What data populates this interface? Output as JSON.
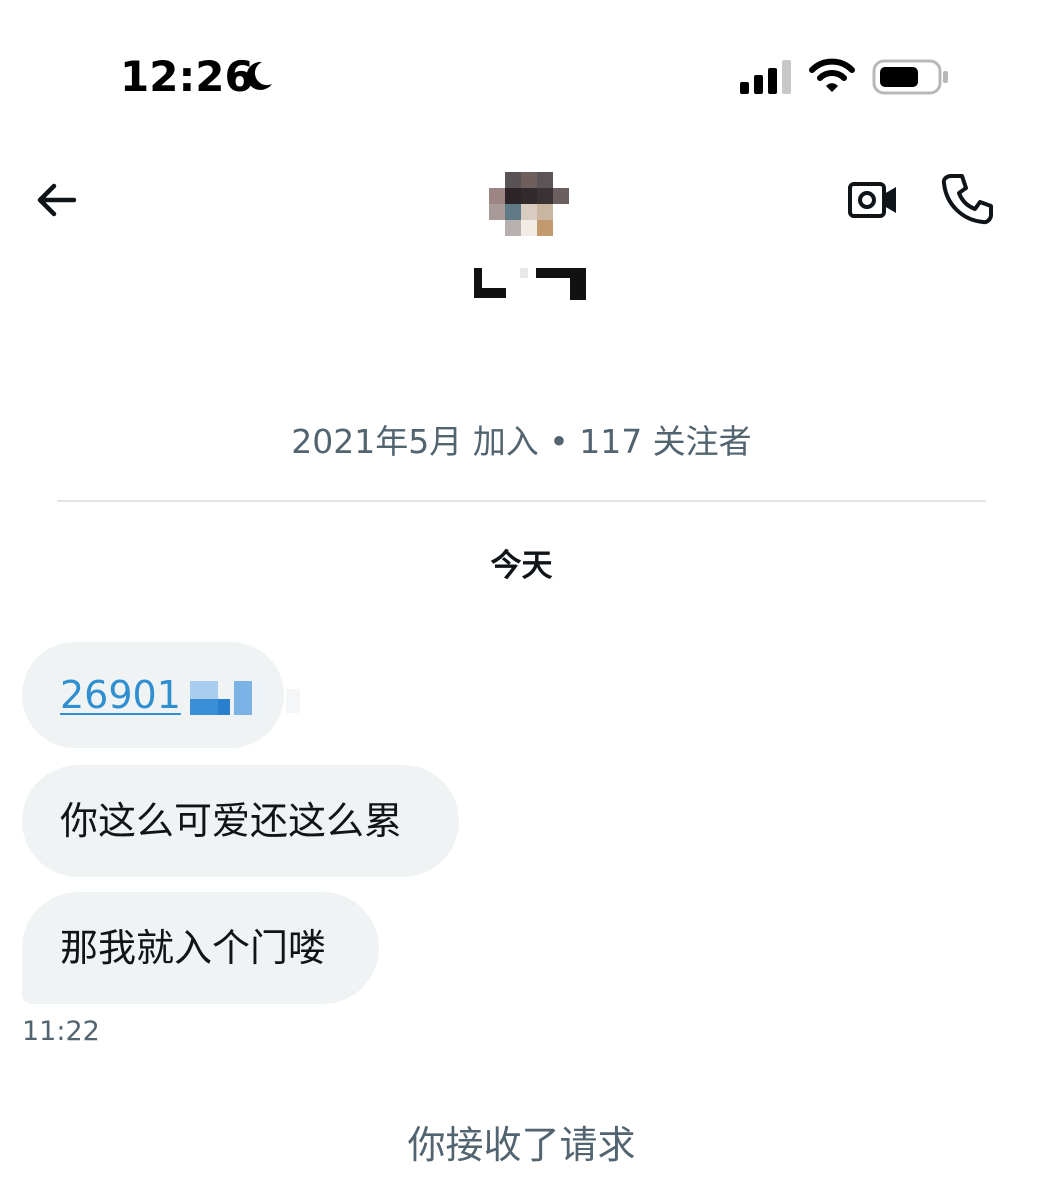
{
  "status_bar": {
    "time": "12:26",
    "focus_icon": "moon-icon",
    "signal_icon": "cellular-signal-icon",
    "wifi_icon": "wifi-icon",
    "battery_icon": "battery-icon"
  },
  "header": {
    "back_icon": "arrow-left-icon",
    "avatar": "pixelated-avatar",
    "video_icon": "video-camera-icon",
    "call_icon": "phone-icon"
  },
  "profile": {
    "meta": "2021年5月 加入 • 117 关注者"
  },
  "conversation": {
    "day_label": "今天",
    "messages": [
      {
        "link": "26901",
        "type": "link"
      },
      {
        "text": "你这么可爱还这么累"
      },
      {
        "text": "那我就入个门喽"
      }
    ],
    "last_time": "11:22",
    "system_note": "你接收了请求"
  },
  "colors": {
    "bubble_bg": "#eff3f4",
    "secondary_text": "#536471",
    "link": "#2f8fd0"
  }
}
